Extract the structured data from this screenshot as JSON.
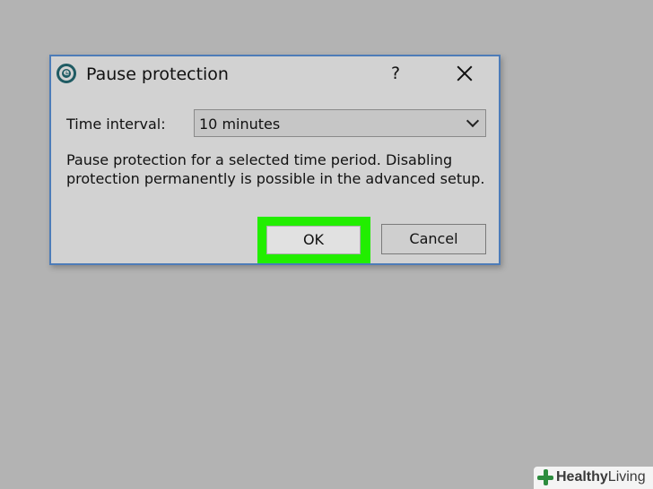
{
  "dialog": {
    "title": "Pause protection",
    "help_label": "?",
    "close_icon": "close-icon",
    "logo_letter": "e",
    "logo_icon": "eset-logo-icon"
  },
  "interval": {
    "label": "Time interval:",
    "selected": "10 minutes",
    "dropdown_icon": "chevron-down-icon"
  },
  "description": {
    "line1": "Pause protection for a selected time period. Disabling",
    "line2": "protection permanently is possible in the advanced setup."
  },
  "buttons": {
    "ok": "OK",
    "cancel": "Cancel"
  },
  "watermark": {
    "brand_bold": "Healthy",
    "brand_light": "Living"
  },
  "colors": {
    "highlight": "#22ee00",
    "dialog_border": "#4d7cb8",
    "logo": "#1f5b63"
  }
}
